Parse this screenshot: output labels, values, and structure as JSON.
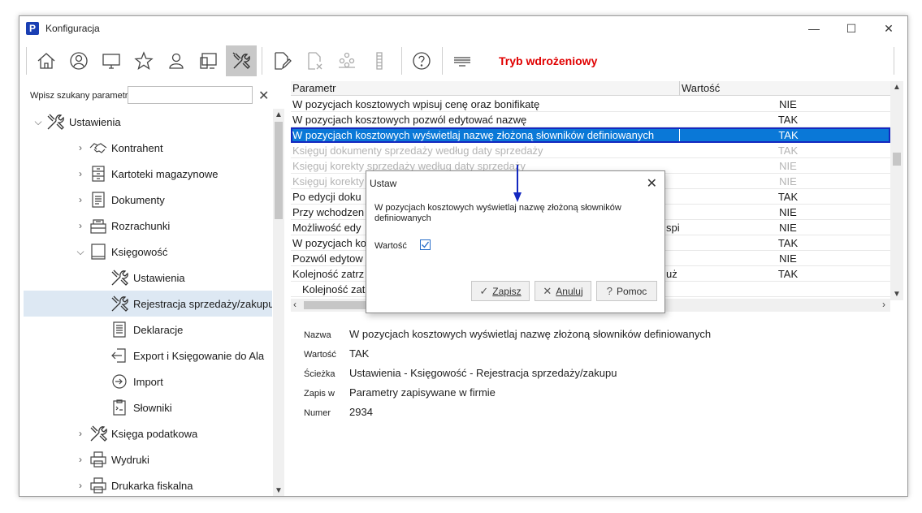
{
  "window": {
    "title": "Konfiguracja",
    "logo": "P"
  },
  "toolbar": {
    "buttons": [
      "home-icon",
      "user-circle-icon",
      "monitor-icon",
      "star-icon",
      "person-icon",
      "devices-icon",
      "tools-icon",
      "document-edit-icon",
      "document-delete-icon",
      "group-icon",
      "list-icon",
      "help-icon",
      "menu-lines-icon"
    ],
    "active": "tools-icon",
    "mode_label": "Tryb wdrożeniowy",
    "mode_color": "#e00000"
  },
  "search": {
    "label": "Wpisz szukany parametr",
    "value": ""
  },
  "tree": {
    "items": [
      {
        "label": "Ustawienia"
      },
      {
        "label": "Kontrahent"
      },
      {
        "label": "Kartoteki magazynowe"
      },
      {
        "label": "Dokumenty"
      },
      {
        "label": "Rozrachunki"
      },
      {
        "label": "Księgowość"
      },
      {
        "label": "Ustawienia"
      },
      {
        "label": "Rejestracja sprzedaży/zakupu"
      },
      {
        "label": "Deklaracje"
      },
      {
        "label": "Export i Księgowanie do Ala"
      },
      {
        "label": "Import"
      },
      {
        "label": "Słowniki"
      },
      {
        "label": "Księga podatkowa"
      },
      {
        "label": "Wydruki"
      },
      {
        "label": "Drukarka fiskalna"
      }
    ]
  },
  "grid": {
    "headers": {
      "param": "Parametr",
      "value": "Wartość"
    },
    "rows": [
      {
        "param": "W pozycjach kosztowych wpisuj cenę oraz bonifikatę",
        "value": "NIE"
      },
      {
        "param": "W pozycjach kosztowych pozwól edytować nazwę",
        "value": "TAK"
      },
      {
        "param": "W pozycjach kosztowych wyświetlaj nazwę złożoną słowników definiowanych",
        "value": "TAK"
      },
      {
        "param": "Księguj dokumenty sprzedaży według daty sprzedaży",
        "value": "TAK"
      },
      {
        "param": "Księguj korekty sprzedaży według daty sprzedaży",
        "value": "NIE"
      },
      {
        "param": "Księguj korekty",
        "value": "NIE"
      },
      {
        "param": "Po edycji doku",
        "value": "TAK"
      },
      {
        "param": "Przy wchodzen",
        "value": "NIE"
      },
      {
        "param": "Możliwość edy",
        "tail": "spi",
        "value": "NIE"
      },
      {
        "param": "W pozycjach ko",
        "value": "TAK"
      },
      {
        "param": "Pozwól edytow",
        "value": "NIE"
      },
      {
        "param": "Kolejność zatrz",
        "tail": "uż",
        "value": "TAK"
      },
      {
        "param": "Kolejność zat",
        "value": ""
      }
    ]
  },
  "details": {
    "name_label": "Nazwa",
    "name_value": "W pozycjach kosztowych wyświetlaj nazwę złożoną słowników definiowanych",
    "value_label": "Wartość",
    "value_value": "TAK",
    "path_label": "Ścieżka",
    "path_value": "Ustawienia - Księgowość - Rejestracja sprzedaży/zakupu",
    "save_label": "Zapis w",
    "save_value": "Parametry zapisywane w firmie",
    "number_label": "Numer",
    "number_value": "2934"
  },
  "dialog": {
    "title": "Ustaw",
    "description": "W pozycjach kosztowych wyświetlaj nazwę złożoną słowników definiowanych",
    "field_label": "Wartość",
    "checked": true,
    "save_button": "Zapisz",
    "cancel_button": "Anuluj",
    "help_button": "Pomoc"
  },
  "colors": {
    "selection": "#0a78d7",
    "tree_selection": "#dde8f3",
    "arrow": "#1428c0"
  }
}
